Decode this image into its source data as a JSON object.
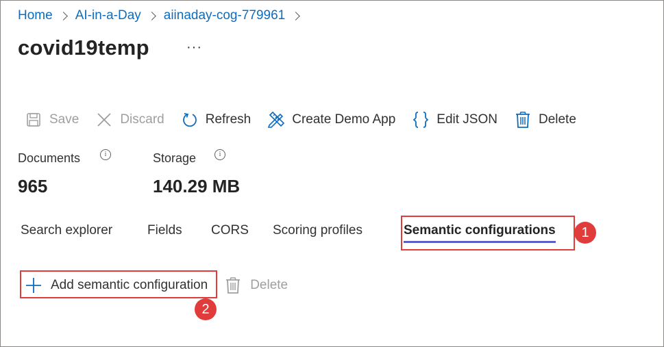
{
  "breadcrumb": {
    "items": [
      "Home",
      "AI-in-a-Day",
      "aiinaday-cog-779961"
    ]
  },
  "page": {
    "title": "covid19temp",
    "more_label": "···"
  },
  "toolbar": {
    "save_label": "Save",
    "discard_label": "Discard",
    "refresh_label": "Refresh",
    "create_demo_app_label": "Create Demo App",
    "edit_json_label": "Edit JSON",
    "delete_label": "Delete"
  },
  "metrics": {
    "documents_label": "Documents",
    "documents_value": "965",
    "storage_label": "Storage",
    "storage_value": "140.29 MB",
    "info_glyph": "i"
  },
  "tabs": [
    {
      "label": "Search explorer",
      "selected": false
    },
    {
      "label": "Fields",
      "selected": false
    },
    {
      "label": "CORS",
      "selected": false
    },
    {
      "label": "Scoring profiles",
      "selected": false
    },
    {
      "label": "Semantic configurations",
      "selected": true
    }
  ],
  "semantic_actions": {
    "add_label": "Add semantic configuration",
    "delete_label": "Delete"
  },
  "annotations": {
    "badge_1": "1",
    "badge_2": "2"
  },
  "colors": {
    "link": "#0f6cbd",
    "disabled": "#a19f9d",
    "icon_blue": "#0f6cbd",
    "tab_underline": "#5b5fc7",
    "annotation_red": "#e03c3c"
  },
  "icons": {
    "save": "save-icon",
    "discard": "close-icon",
    "refresh": "refresh-icon",
    "create_demo_app": "pencil-ruler-icon",
    "edit_json": "braces-icon",
    "delete": "trash-icon",
    "info": "info-icon",
    "add": "plus-icon"
  }
}
